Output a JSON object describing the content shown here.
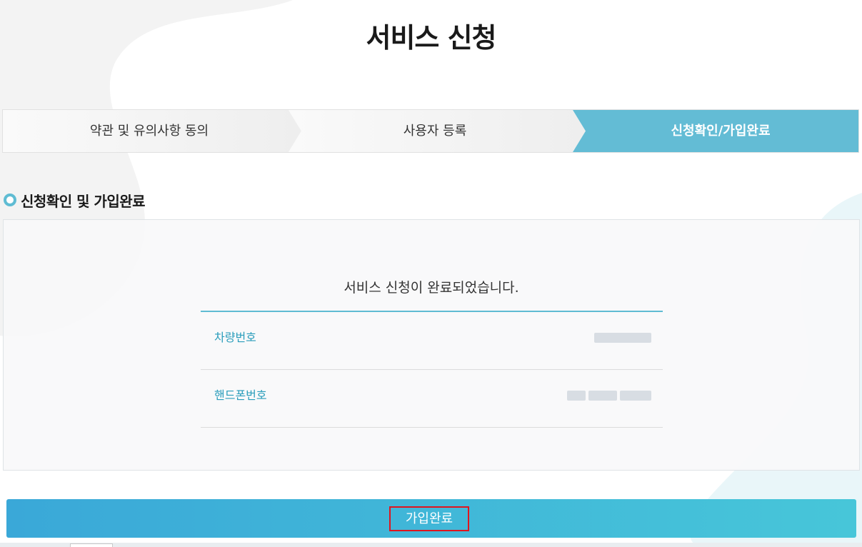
{
  "page": {
    "title": "서비스 신청"
  },
  "steps": [
    {
      "label": "약관 및 유의사항 동의",
      "active": false
    },
    {
      "label": "사용자 등록",
      "active": false
    },
    {
      "label": "신청확인/가입완료",
      "active": true
    }
  ],
  "section": {
    "title": "신청확인 및 가입완료"
  },
  "result": {
    "message": "서비스 신청이 완료되었습니다.",
    "rows": [
      {
        "label": "차량번호",
        "value": ""
      },
      {
        "label": "핸드폰번호",
        "value": ""
      }
    ]
  },
  "actions": {
    "complete_label": "가입완료"
  },
  "colors": {
    "accent": "#5fbcd3",
    "active_step": "#63bcd5",
    "button_start": "#3aa8d8",
    "button_end": "#47c6d9",
    "highlight": "#e0141e"
  }
}
